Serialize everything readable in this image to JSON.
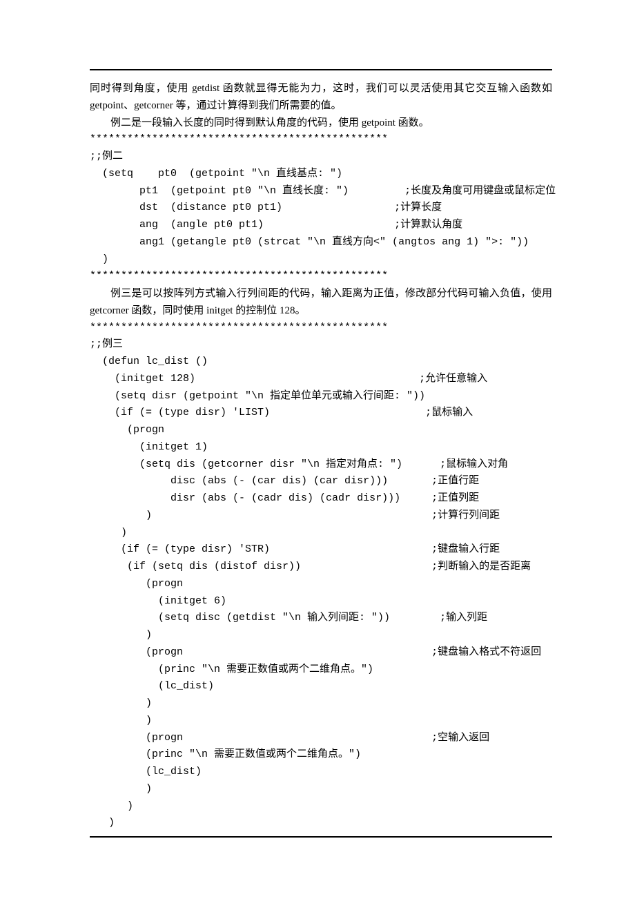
{
  "paragraphs": {
    "p1": "同时得到角度，使用 getdist 函数就显得无能为力，这时，我们可以灵活使用其它交互输入函数如 getpoint、getcorner 等，通过计算得到我们所需要的值。",
    "p2": "例二是一段输入长度的同时得到默认角度的代码，使用 getpoint 函数。",
    "p3": "例三是可以按阵列方式输入行列间距的代码，输入距离为正值，修改部分代码可输入负值，使用 getcorner 函数，同时使用 initget 的控制位 128。"
  },
  "separators": {
    "s1": "************************************************",
    "s2": "************************************************",
    "s3": "************************************************"
  },
  "example2": {
    "label": ";;例二",
    "l1": "  (setq    pt0  (getpoint \"\\n 直线基点: \")",
    "l2": "        pt1  (getpoint pt0 \"\\n 直线长度: \")         ;长度及角度可用键盘或鼠标定位",
    "l3": "        dst  (distance pt0 pt1)                  ;计算长度",
    "l4": "        ang  (angle pt0 pt1)                     ;计算默认角度",
    "l5": "        ang1 (getangle pt0 (strcat \"\\n 直线方向<\" (angtos ang 1) \">: \"))",
    "l6": "  )"
  },
  "example3": {
    "label": ";;例三",
    "l1": "  (defun lc_dist ()",
    "l2": "    (initget 128)                                    ;允许任意输入",
    "l3": "    (setq disr (getpoint \"\\n 指定单位单元或输入行间距: \"))",
    "l4": "    (if (= (type disr) 'LIST)                         ;鼠标输入",
    "l5": "      (progn",
    "l6": "        (initget 1)",
    "l7": "        (setq dis (getcorner disr \"\\n 指定对角点: \")      ;鼠标输入对角",
    "l8": "             disc (abs (- (car dis) (car disr)))       ;正值行距",
    "l9": "             disr (abs (- (cadr dis) (cadr disr)))     ;正值列距",
    "l10": "         )                                             ;计算行列间距",
    "l11": "     )",
    "l12": "     (if (= (type disr) 'STR)                          ;键盘输入行距",
    "l13": "      (if (setq dis (distof disr))                     ;判断输入的是否距离",
    "l14": "         (progn",
    "l15": "           (initget 6)",
    "l16": "           (setq disc (getdist \"\\n 输入列间距: \"))        ;输入列距",
    "l17": "         )",
    "l18": "         (progn                                        ;键盘输入格式不符返回",
    "l19": "           (princ \"\\n 需要正数值或两个二维角点。\")",
    "l20": "           (lc_dist)",
    "l21": "         )",
    "l22": "         )",
    "l23": "         (progn                                        ;空输入返回",
    "l24": "         (princ \"\\n 需要正数值或两个二维角点。\")",
    "l25": "         (lc_dist)",
    "l26": "         )",
    "l27": "      )",
    "l28": "   )"
  }
}
